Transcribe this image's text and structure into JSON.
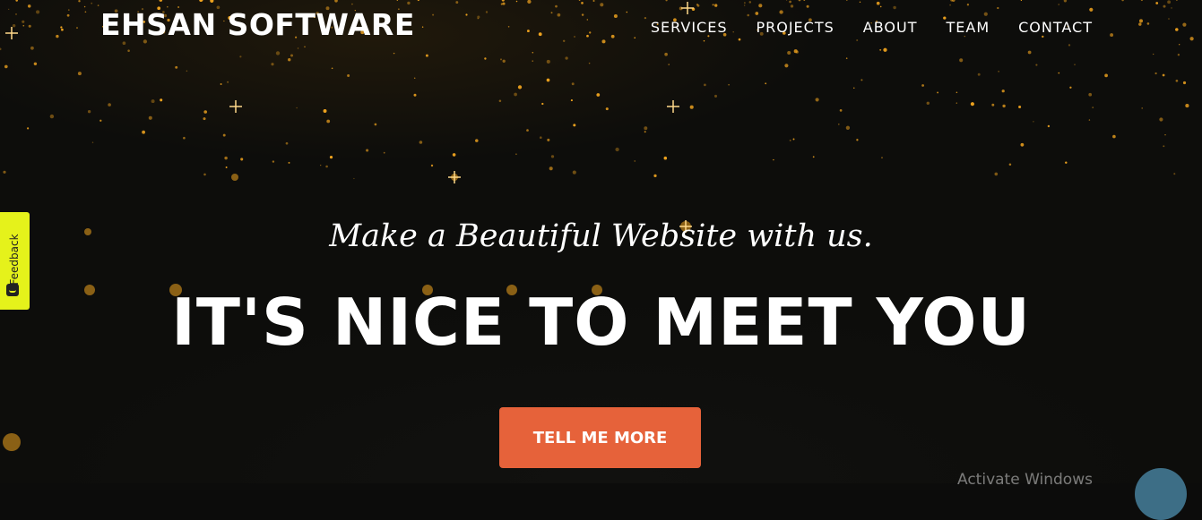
{
  "header": {
    "brand": "EHSAN SOFTWARE",
    "nav": [
      "SERVICES",
      "PROJECTS",
      "ABOUT",
      "TEAM",
      "CONTACT"
    ]
  },
  "hero": {
    "subheading": "Make a Beautiful Website with us.",
    "heading": "IT'S NICE TO MEET YOU",
    "cta": "TELL ME MORE"
  },
  "feedback": {
    "label": "Feedback"
  },
  "os_overlay": {
    "watermark": "Activate Windows"
  },
  "colors": {
    "cta": "#e6623a",
    "feedback_tab": "#e5f21b",
    "chat_bubble": "#3d6e86",
    "background": "#0d0d0b",
    "particles": "#f2a51f"
  }
}
